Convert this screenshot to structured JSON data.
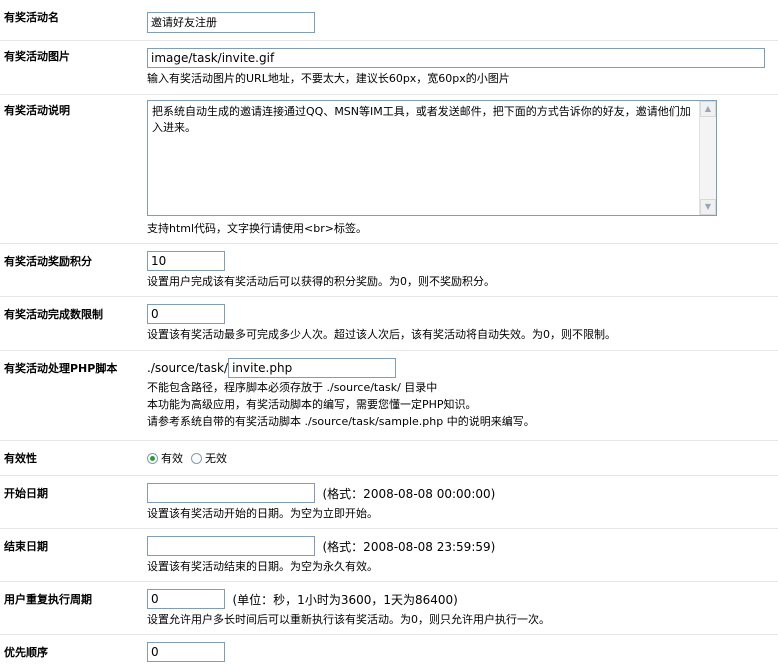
{
  "fields": {
    "name": {
      "label": "有奖活动名",
      "value": "邀请好友注册"
    },
    "image": {
      "label": "有奖活动图片",
      "value": "image/task/invite.gif",
      "hint": "输入有奖活动图片的URL地址，不要太大，建议长60px，宽60px的小图片"
    },
    "desc": {
      "label": "有奖活动说明",
      "value": "把系统自动生成的邀请连接通过QQ、MSN等IM工具，或者发送邮件，把下面的方式告诉你的好友，邀请他们加入进来。",
      "hint": "支持html代码，文字换行请使用<br>标签。"
    },
    "credit": {
      "label": "有奖活动奖励积分",
      "value": "10",
      "hint": "设置用户完成该有奖活动后可以获得的积分奖励。为0，则不奖励积分。"
    },
    "maxnum": {
      "label": "有奖活动完成数限制",
      "value": "0",
      "hint": "设置该有奖活动最多可完成多少人次。超过该人次后，该有奖活动将自动失效。为0，则不限制。"
    },
    "script": {
      "label": "有奖活动处理PHP脚本",
      "prefix": "./source/task/",
      "value": "invite.php",
      "hint1": "不能包含路径，程序脚本必须存放于 ./source/task/ 目录中",
      "hint2": "本功能为高级应用，有奖活动脚本的编写，需要您懂一定PHP知识。",
      "hint3": "请参考系统自带的有奖活动脚本 ./source/task/sample.php 中的说明来编写。"
    },
    "available": {
      "label": "有效性",
      "opt_yes": "有效",
      "opt_no": "无效",
      "selected": "有效"
    },
    "starttime": {
      "label": "开始日期",
      "value": "",
      "format": "(格式：2008-08-08 00:00:00)",
      "hint": "设置该有奖活动开始的日期。为空为立即开始。"
    },
    "endtime": {
      "label": "结束日期",
      "value": "",
      "format": "(格式：2008-08-08 23:59:59)",
      "hint": "设置该有奖活动结束的日期。为空为永久有效。"
    },
    "nexttime": {
      "label": "用户重复执行周期",
      "value": "0",
      "unit": "(单位：秒，1小时为3600，1天为86400)",
      "hint": "设置允许用户多长时间后可以重新执行该有奖活动。为0，则只允许用户执行一次。"
    },
    "order": {
      "label": "优先顺序",
      "value": "0"
    }
  }
}
